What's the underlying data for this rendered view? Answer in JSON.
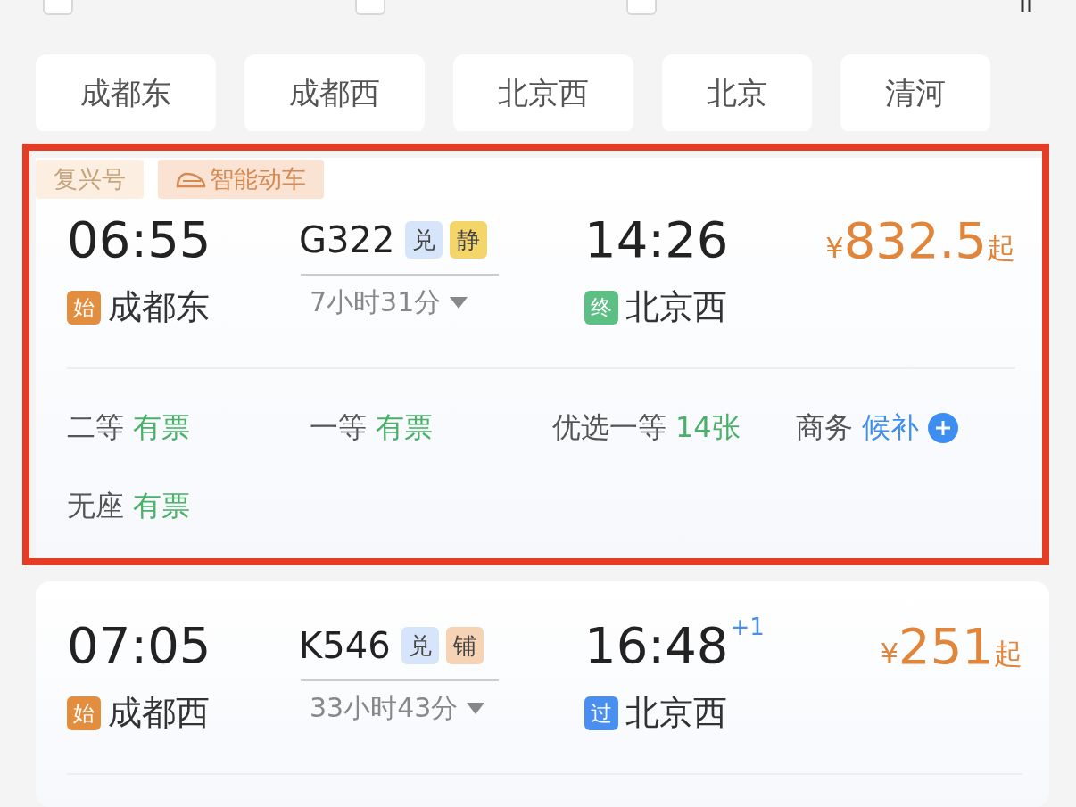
{
  "filters": [
    {
      "checked": false
    },
    {
      "checked": false
    },
    {
      "checked": false
    }
  ],
  "stations": [
    {
      "label": "成都东"
    },
    {
      "label": "成都西"
    },
    {
      "label": "北京西"
    },
    {
      "label": "北京"
    },
    {
      "label": "清河"
    }
  ],
  "trains": [
    {
      "highlighted": true,
      "tags": [
        {
          "label": "复兴号",
          "kind": "plain"
        },
        {
          "label": "智能动车",
          "kind": "smart"
        }
      ],
      "depart": {
        "time": "06:55",
        "station": "成都东",
        "badge": {
          "label": "始",
          "kind": "start"
        }
      },
      "number": "G322",
      "number_badges": [
        {
          "label": "兑",
          "color": "#d6e5fa"
        },
        {
          "label": "静",
          "color": "#f3d56a"
        }
      ],
      "duration": "7小时31分",
      "arrive": {
        "time": "14:26",
        "station": "北京西",
        "badge": {
          "label": "终",
          "kind": "end"
        }
      },
      "price": {
        "currency": "¥",
        "amount": "832.5",
        "suffix": "起"
      },
      "seats": [
        {
          "class": "二等",
          "status": "有票",
          "kind": "available"
        },
        {
          "class": "一等",
          "status": "有票",
          "kind": "available"
        },
        {
          "class": "优选一等",
          "status": "14张",
          "kind": "available"
        },
        {
          "class": "商务",
          "status": "候补",
          "kind": "waitlist"
        },
        {
          "class": "无座",
          "status": "有票",
          "kind": "available"
        }
      ]
    },
    {
      "highlighted": false,
      "depart": {
        "time": "07:05",
        "station": "成都西",
        "badge": {
          "label": "始",
          "kind": "start"
        }
      },
      "number": "K546",
      "number_badges": [
        {
          "label": "兑",
          "color": "#d6e5fa"
        },
        {
          "label": "铺",
          "color": "#f6d3b4"
        }
      ],
      "duration": "33小时43分",
      "arrive": {
        "time": "16:48",
        "day_offset": "+1",
        "station": "北京西",
        "badge": {
          "label": "过",
          "kind": "pass"
        }
      },
      "price": {
        "currency": "¥",
        "amount": "251",
        "suffix": "起"
      }
    }
  ]
}
